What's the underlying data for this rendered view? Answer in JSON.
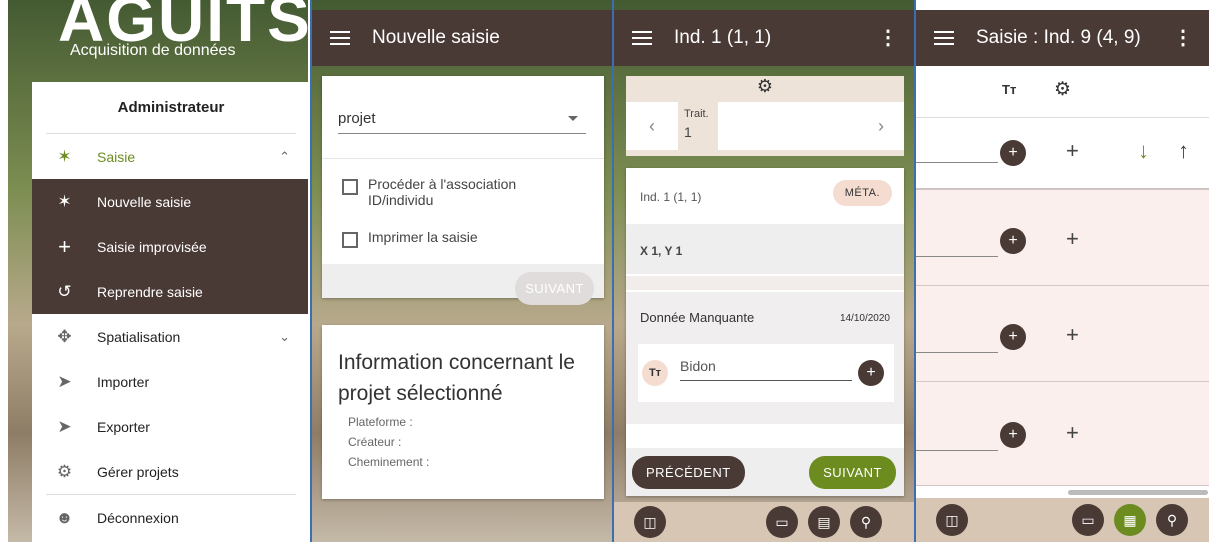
{
  "panel1": {
    "logo": "AGUITS",
    "subtitle": "Acquisition de données",
    "menu_header": "Administrateur",
    "items": [
      {
        "label": "Saisie",
        "icon": "leaf-icon"
      },
      {
        "label": "Nouvelle saisie",
        "icon": "leaf-icon"
      },
      {
        "label": "Saisie improvisée",
        "icon": "plus-icon"
      },
      {
        "label": "Reprendre saisie",
        "icon": "history-icon"
      },
      {
        "label": "Spatialisation",
        "icon": "move-icon"
      },
      {
        "label": "Importer",
        "icon": "send-icon"
      },
      {
        "label": "Exporter",
        "icon": "send-icon"
      },
      {
        "label": "Gérer projets",
        "icon": "gear-icon"
      },
      {
        "label": "Déconnexion",
        "icon": "account-icon"
      }
    ]
  },
  "panel2": {
    "title": "Nouvelle saisie",
    "select_value": "projet",
    "check_assoc": "Procéder à l'association ID/individu",
    "check_print": "Imprimer la saisie",
    "next_button": "SUIVANT",
    "info_title": "Information concernant le projet sélectionné",
    "platform_label": "Plateforme :",
    "creator_label": "Créateur :",
    "path_label": "Cheminement :"
  },
  "panel3": {
    "title": "Ind. 1 (1, 1)",
    "trait_label": "Trait.",
    "trait_value": "1",
    "ind_label": "Ind. 1 (1, 1)",
    "meta_button": "MÉTA.",
    "coords": "X 1, Y 1",
    "missing_label": "Donnée Manquante",
    "missing_date": "14/10/2020",
    "tt_badge": "Tт",
    "field_value": "Bidon",
    "prev_button": "PRÉCÉDENT",
    "next_button": "SUIVANT"
  },
  "panel4": {
    "title": "Saisie : Ind. 9 (4, 9)",
    "tt_header": "Tт"
  },
  "colors": {
    "brown": "#4a3a35",
    "green": "#6c8c20",
    "pink": "#f4ddd0"
  }
}
